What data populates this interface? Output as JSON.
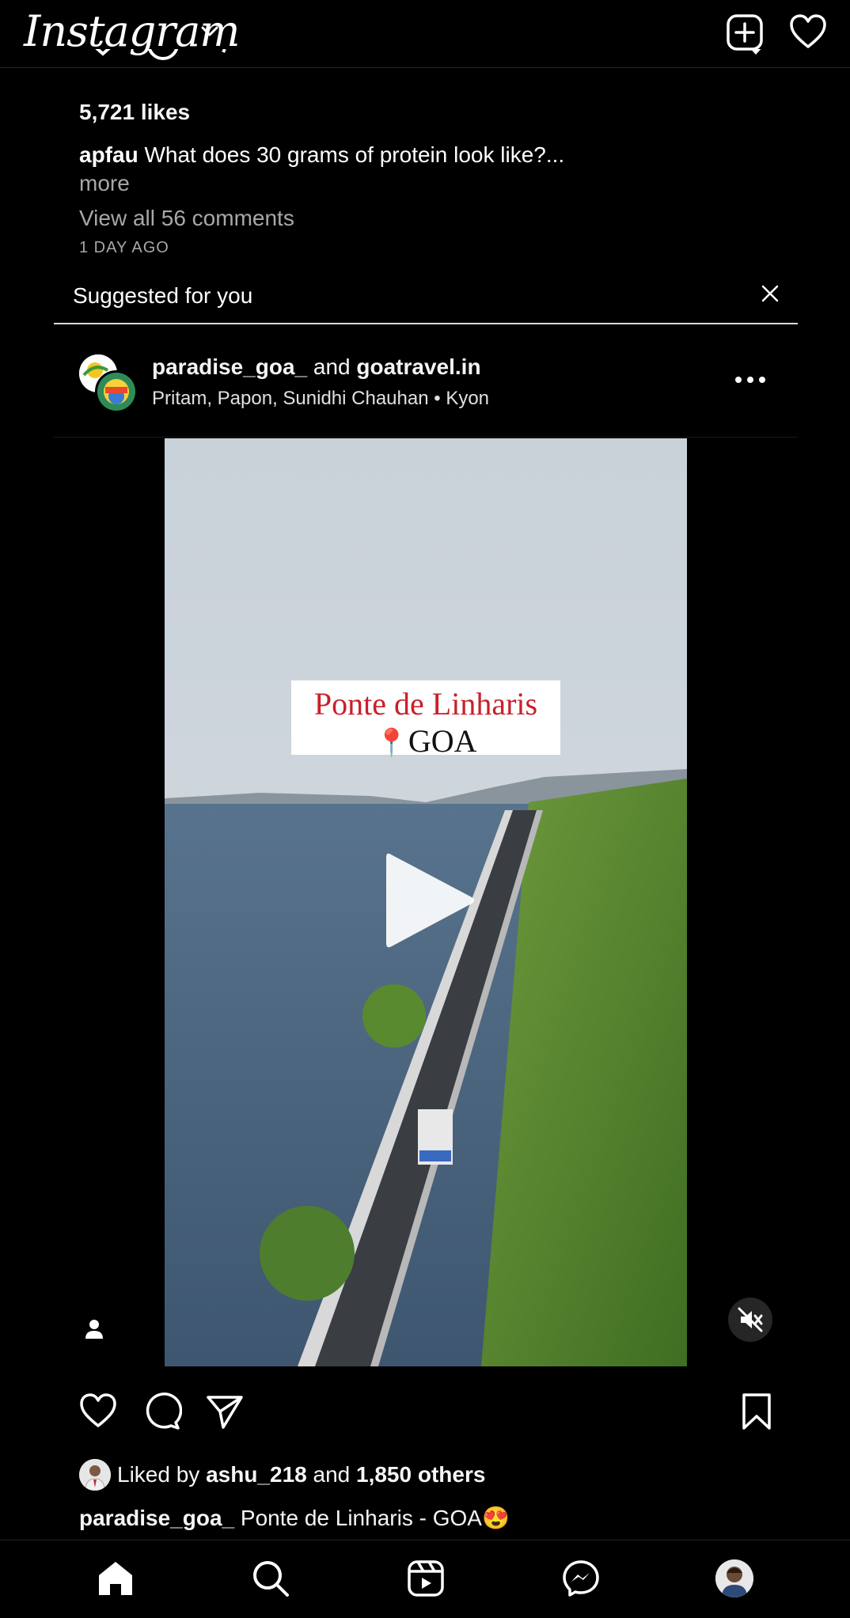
{
  "app": {
    "logo_text": "Instagram"
  },
  "prev_post": {
    "likes": "5,721 likes",
    "caption_user": "apfau",
    "caption_text": "What does 30 grams of protein look like?...",
    "more": "more",
    "view_comments": "View all 56 comments",
    "time": "1 DAY AGO"
  },
  "suggested": {
    "label": "Suggested for you"
  },
  "post": {
    "user1": "paradise_goa_",
    "and": "and",
    "user2": "goatravel.in",
    "audio_artists": "Pritam, Papon, Sunidhi Chauhan",
    "audio_sep": "•",
    "audio_song": "Kyon",
    "overlay_line1": "Ponte de Linharis",
    "overlay_line2": "GOA",
    "liked_prefix": "Liked by",
    "liked_user": "ashu_218",
    "liked_and": "and",
    "liked_others": "1,850 others",
    "caption_user": "paradise_goa_",
    "caption_text": "Ponte de Linharis - GOA",
    "caption_emoji": "😍"
  },
  "icons": {
    "top": [
      "chevron-down-icon",
      "new-post-icon",
      "heart-icon"
    ],
    "actions": [
      "heart-icon",
      "comment-icon",
      "share-icon",
      "bookmark-icon"
    ],
    "nav": [
      "home-icon",
      "search-icon",
      "reels-icon",
      "messenger-icon",
      "profile-avatar"
    ]
  },
  "colors": {
    "background": "#000000",
    "text": "#f5f5f5",
    "muted": "#a8a8a8",
    "overlay_red": "#c8202a"
  }
}
